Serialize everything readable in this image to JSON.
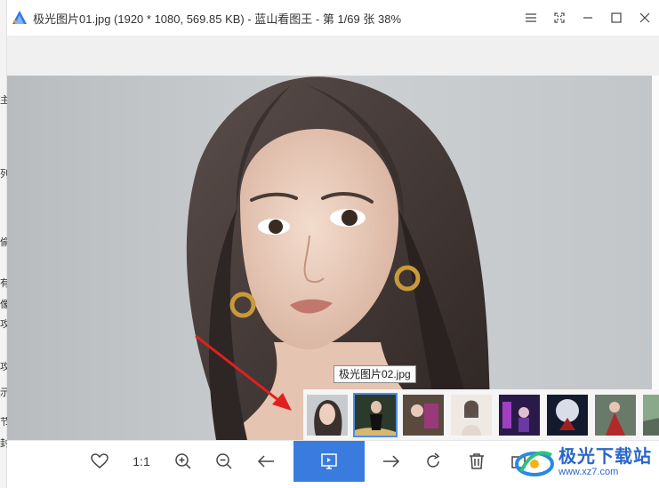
{
  "window": {
    "title": "极光图片01.jpg (1920 * 1080, 569.85 KB) - 蓝山看图王 - 第 1/69 张 38%",
    "controls": [
      "menu-icon",
      "fullscreen-icon",
      "minimize-icon",
      "maximize-icon",
      "close-icon"
    ]
  },
  "background_window": {
    "glyphs": [
      "列",
      "主",
      "偷",
      "有",
      "像",
      "攻",
      "攻",
      "示",
      "节",
      "封"
    ]
  },
  "viewer": {
    "image_description_icon": "portrait-image"
  },
  "tooltip": {
    "text": "极光图片02.jpg"
  },
  "thumbnails": [
    {
      "name": "thumb-1",
      "active": false
    },
    {
      "name": "thumb-2",
      "active": true
    },
    {
      "name": "thumb-3",
      "active": false
    },
    {
      "name": "thumb-4",
      "active": false
    },
    {
      "name": "thumb-5",
      "active": false
    },
    {
      "name": "thumb-6",
      "active": false
    },
    {
      "name": "thumb-7",
      "active": false
    },
    {
      "name": "thumb-8",
      "active": false
    }
  ],
  "toolbar": {
    "favorite_icon": "heart-icon",
    "actual_size_label": "1:1",
    "zoom_in_icon": "zoom-in-icon",
    "zoom_out_icon": "zoom-out-icon",
    "prev_icon": "arrow-left-icon",
    "slideshow_icon": "slideshow-icon",
    "next_icon": "arrow-right-icon",
    "rotate_icon": "rotate-icon",
    "delete_icon": "trash-icon"
  },
  "watermark": {
    "title": "极光下载站",
    "url": "www.xz7.com"
  },
  "colors": {
    "accent": "#3a7be0",
    "thumb_active_border": "#4e8ee8",
    "annotation_arrow": "#e02020"
  }
}
